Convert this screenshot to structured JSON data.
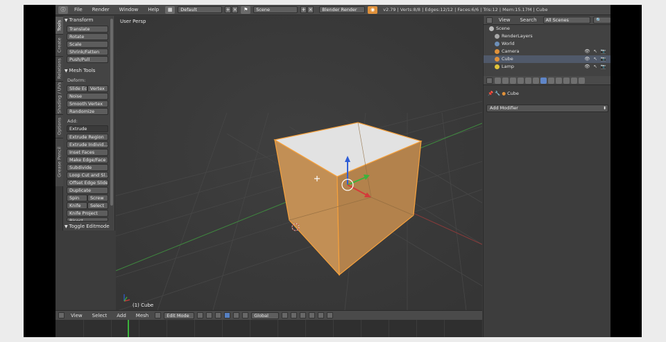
{
  "header": {
    "menu": [
      "File",
      "Render",
      "Window",
      "Help"
    ],
    "screen_layout": "Default",
    "scene": "Scene",
    "render_engine": "Blender Render",
    "stats": "v2.79 | Verts:8/8 | Edges:12/12 | Faces:6/6 | Tris:12 | Mem:15.17M | Cube"
  },
  "tool_tabs": [
    "Tools",
    "Create",
    "Relations",
    "Shading / UVs",
    "Options",
    "Grease Pencil"
  ],
  "transform_panel": {
    "title": "Transform",
    "buttons": [
      "Translate",
      "Rotate",
      "Scale",
      "Shrink/Fatten",
      "Push/Pull"
    ]
  },
  "mesh_tools_panel": {
    "title": "Mesh Tools",
    "deform_label": "Deform:",
    "slide_edge": "Slide Ed",
    "vertex": "Vertex",
    "noise": "Noise",
    "smooth_vertex": "Smooth Vertex",
    "randomize": "Randomize",
    "add_label": "Add:",
    "extrude": "Extrude",
    "extrude_region": "Extrude Region",
    "extrude_individual": "Extrude Individ...",
    "inset_faces": "Inset Faces",
    "make_edge_face": "Make Edge/Face",
    "subdivide": "Subdivide",
    "loop_cut": "Loop Cut and Sl...",
    "offset_edge_slide": "Offset Edge Slide",
    "duplicate": "Duplicate",
    "spin": "Spin",
    "screw": "Screw",
    "knife": "Knife",
    "select": "Select",
    "knife_project": "Knife Project",
    "bisect": "Bisect"
  },
  "toggle_editmode": "Toggle Editmode",
  "viewport": {
    "view_label": "User Persp",
    "object_label": "(1) Cube"
  },
  "viewport_header": {
    "menu": [
      "View",
      "Select",
      "Add",
      "Mesh"
    ],
    "mode": "Edit Mode",
    "orientation": "Global"
  },
  "outliner": {
    "menu": [
      "View",
      "Search"
    ],
    "filter": "All Scenes",
    "items": [
      {
        "label": "Scene",
        "color": "#b9b9b9"
      },
      {
        "label": "RenderLayers",
        "color": "#a8a8a8"
      },
      {
        "label": "World",
        "color": "#6d8fb8"
      },
      {
        "label": "Camera",
        "color": "#e0913a"
      },
      {
        "label": "Cube",
        "color": "#e0913a"
      },
      {
        "label": "Lamp",
        "color": "#e0c33a"
      }
    ]
  },
  "properties": {
    "breadcrumb": "Cube",
    "add_modifier": "Add Modifier"
  },
  "colors": {
    "cube_face": "#c99559",
    "cube_top": "#e2e2e2",
    "select_outline": "#f6a13c",
    "axis_x": "#d43a3a",
    "axis_y": "#3bb33b",
    "axis_z": "#2f5ed6"
  }
}
